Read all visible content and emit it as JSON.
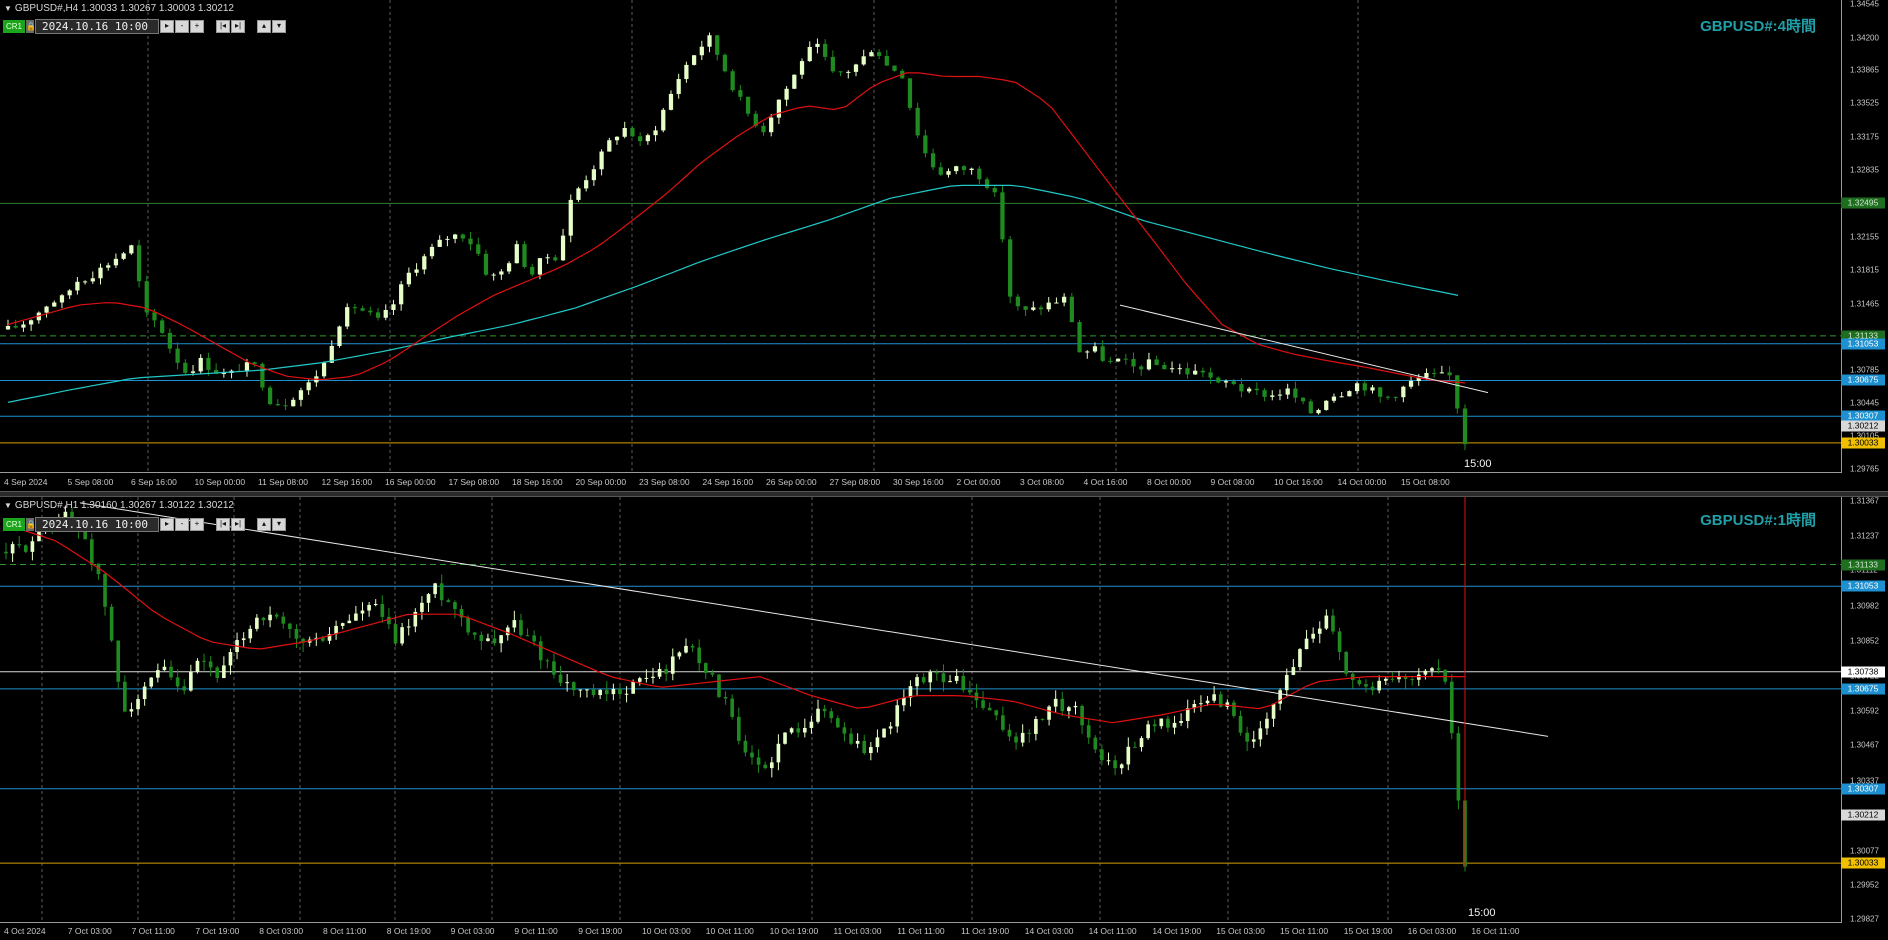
{
  "colors": {
    "background": "#000000",
    "bull": "#e6ffc8",
    "bear": "#1f8a1f",
    "ma_fast": "#e01010",
    "ma_slow": "#20c8c8",
    "grid": "#5a5a5a",
    "level_blue": "#1e90d0",
    "level_gold": "#d4a000",
    "level_green": "#2e7d2e",
    "level_dash": "#2e9a2e",
    "title": "#1f9fa8"
  },
  "panel1": {
    "info": "GBPUSD#,H4  1.30033 1.30267 1.30003 1.30212",
    "cr_label": "CR1",
    "datetime": "2024.10.16 10:00",
    "buttons": [
      "▸",
      "-",
      "+",
      "|◂",
      "▸|",
      "▴",
      "▾"
    ],
    "title": "GBPUSD#:4時間",
    "time_marker": "15:00",
    "y_labels": [
      "1.34545",
      "1.34200",
      "1.33865",
      "1.33525",
      "1.33175",
      "1.32835",
      "1.32495",
      "1.32155",
      "1.31815",
      "1.31465",
      "1.31125",
      "1.30785",
      "1.30445",
      "1.30105",
      "1.29765"
    ],
    "x_labels": [
      "4 Sep 2024",
      "5 Sep 08:00",
      "6 Sep 16:00",
      "10 Sep 00:00",
      "11 Sep 08:00",
      "12 Sep 16:00",
      "16 Sep 00:00",
      "17 Sep 08:00",
      "18 Sep 16:00",
      "20 Sep 00:00",
      "23 Sep 08:00",
      "24 Sep 16:00",
      "26 Sep 00:00",
      "27 Sep 08:00",
      "30 Sep 16:00",
      "2 Oct 00:00",
      "3 Oct 08:00",
      "4 Oct 16:00",
      "8 Oct 00:00",
      "9 Oct 08:00",
      "10 Oct 16:00",
      "14 Oct 00:00",
      "15 Oct 08:00"
    ],
    "price_tags": [
      {
        "value": "1.32495",
        "kind": "green"
      },
      {
        "value": "1.31133",
        "kind": "green"
      },
      {
        "value": "1.31053",
        "kind": "blue"
      },
      {
        "value": "1.30675",
        "kind": "blue"
      },
      {
        "value": "1.30307",
        "kind": "blue"
      },
      {
        "value": "1.30212",
        "kind": "gray"
      },
      {
        "value": "1.30033",
        "kind": "gold"
      }
    ]
  },
  "panel2": {
    "info": "GBPUSD#,H1  1.30160 1.30267 1.30122 1.30212",
    "cr_label": "CR1",
    "datetime": "2024.10.16 10:00",
    "buttons": [
      "▸",
      "-",
      "+",
      "|◂",
      "▸|",
      "▴",
      "▾"
    ],
    "title": "GBPUSD#:1時間",
    "time_marker": "15:00",
    "y_labels": [
      "1.31367",
      "1.31237",
      "1.31112",
      "1.30982",
      "1.30852",
      "1.30722",
      "1.30592",
      "1.30467",
      "1.30337",
      "1.30207",
      "1.30077",
      "1.29952",
      "1.29827"
    ],
    "x_labels": [
      "4 Oct 2024",
      "7 Oct 03:00",
      "7 Oct 11:00",
      "7 Oct 19:00",
      "8 Oct 03:00",
      "8 Oct 11:00",
      "8 Oct 19:00",
      "9 Oct 03:00",
      "9 Oct 11:00",
      "9 Oct 19:00",
      "10 Oct 03:00",
      "10 Oct 11:00",
      "10 Oct 19:00",
      "11 Oct 03:00",
      "11 Oct 11:00",
      "11 Oct 19:00",
      "14 Oct 03:00",
      "14 Oct 11:00",
      "14 Oct 19:00",
      "15 Oct 03:00",
      "15 Oct 11:00",
      "15 Oct 19:00",
      "16 Oct 03:00",
      "16 Oct 11:00"
    ],
    "price_tags": [
      {
        "value": "1.31133",
        "kind": "green"
      },
      {
        "value": "1.31053",
        "kind": "blue"
      },
      {
        "value": "1.30738",
        "kind": "white"
      },
      {
        "value": "1.30675",
        "kind": "blue"
      },
      {
        "value": "1.30307",
        "kind": "blue"
      },
      {
        "value": "1.30212",
        "kind": "gray"
      },
      {
        "value": "1.30033",
        "kind": "gold"
      }
    ]
  },
  "chart_data": [
    {
      "type": "candlestick",
      "title": "GBPUSD#:4時間",
      "timeframe": "H4",
      "ylim": [
        1.29765,
        1.34545
      ],
      "levels": [
        1.32495,
        1.31133,
        1.31053,
        1.30675,
        1.30307,
        1.30033
      ],
      "close_path": [
        1.312,
        1.3125,
        1.3135,
        1.3148,
        1.3152,
        1.317,
        1.3175,
        1.3185,
        1.3195,
        1.3205,
        1.3135,
        1.3125,
        1.3095,
        1.3075,
        1.3088,
        1.3078,
        1.3072,
        1.3082,
        1.3082,
        1.3048,
        1.3042,
        1.3055,
        1.3065,
        1.3085,
        1.3125,
        1.3145,
        1.3138,
        1.3128,
        1.3145,
        1.3175,
        1.319,
        1.3205,
        1.3215,
        1.3218,
        1.3205,
        1.3172,
        1.318,
        1.3205,
        1.3175,
        1.3195,
        1.3195,
        1.3255,
        1.3275,
        1.3295,
        1.3318,
        1.3328,
        1.331,
        1.3325,
        1.3355,
        1.3385,
        1.3405,
        1.342,
        1.3392,
        1.3362,
        1.3338,
        1.3325,
        1.3355,
        1.3375,
        1.3405,
        1.341,
        1.3382,
        1.3385,
        1.3395,
        1.3412,
        1.339,
        1.3385,
        1.3328,
        1.3292,
        1.328,
        1.3285,
        1.3285,
        1.3275,
        1.3252,
        1.3145,
        1.3138,
        1.3142,
        1.3148,
        1.3152,
        1.3095,
        1.31,
        1.3085,
        1.3088,
        1.308,
        1.3085,
        1.3082,
        1.308,
        1.3075,
        1.3078,
        1.3062,
        1.3068,
        1.3055,
        1.3055,
        1.3052,
        1.3058,
        1.3045,
        1.3032,
        1.3052,
        1.3055,
        1.3065,
        1.306,
        1.3048,
        1.3055,
        1.3065,
        1.3072,
        1.3072,
        1.3072,
        1.3002
      ],
      "ma_fast_path": [
        1.3125,
        1.3135,
        1.3145,
        1.3148,
        1.3142,
        1.3125,
        1.3105,
        1.3085,
        1.3072,
        1.3068,
        1.3072,
        1.3088,
        1.3112,
        1.3135,
        1.3155,
        1.317,
        1.3185,
        1.3205,
        1.3232,
        1.326,
        1.3292,
        1.3318,
        1.334,
        1.335,
        1.3345,
        1.3372,
        1.3385,
        1.338,
        1.338,
        1.3375,
        1.3352,
        1.3305,
        1.3258,
        1.3212,
        1.3165,
        1.3125,
        1.3105,
        1.3095,
        1.3088,
        1.3082,
        1.3075,
        1.3068,
        1.3065
      ],
      "ma_slow_path": [
        1.3045,
        1.3058,
        1.307,
        1.3074,
        1.3078,
        1.3086,
        1.3098,
        1.3112,
        1.3125,
        1.3142,
        1.3165,
        1.319,
        1.3212,
        1.3232,
        1.3255,
        1.3268,
        1.3268,
        1.3255,
        1.3232,
        1.3215,
        1.3198,
        1.3182,
        1.3168,
        1.3155
      ],
      "trendline": {
        "from": 1.3145,
        "to": 1.3055
      }
    },
    {
      "type": "candlestick",
      "title": "GBPUSD#:1時間",
      "timeframe": "H1",
      "ylim": [
        1.29827,
        1.31367
      ],
      "levels": [
        1.31133,
        1.31053,
        1.30738,
        1.30675,
        1.30307,
        1.30033
      ],
      "close_path": [
        1.3118,
        1.312,
        1.3128,
        1.3132,
        1.3125,
        1.3102,
        1.306,
        1.3065,
        1.3075,
        1.3065,
        1.3078,
        1.3072,
        1.3085,
        1.3095,
        1.3092,
        1.3085,
        1.3085,
        1.309,
        1.3095,
        1.3098,
        1.3085,
        1.3095,
        1.3105,
        1.3098,
        1.3088,
        1.3085,
        1.3092,
        1.3085,
        1.3075,
        1.3068,
        1.3065,
        1.3065,
        1.3068,
        1.3072,
        1.3075,
        1.3085,
        1.3075,
        1.3062,
        1.3042,
        1.3038,
        1.305,
        1.3055,
        1.306,
        1.3052,
        1.3045,
        1.305,
        1.3062,
        1.3072,
        1.3072,
        1.307,
        1.3062,
        1.3055,
        1.3048,
        1.3055,
        1.3062,
        1.306,
        1.3045,
        1.3038,
        1.3048,
        1.3055,
        1.3055,
        1.306,
        1.3065,
        1.306,
        1.3045,
        1.3058,
        1.3075,
        1.3088,
        1.3095,
        1.3072,
        1.3068,
        1.307,
        1.3072,
        1.3075,
        1.3072,
        1.3002
      ],
      "ma_fast_path": [
        1.3128,
        1.3122,
        1.311,
        1.3095,
        1.3085,
        1.3082,
        1.3085,
        1.309,
        1.3095,
        1.3095,
        1.3088,
        1.308,
        1.3072,
        1.3068,
        1.307,
        1.3072,
        1.3065,
        1.306,
        1.3065,
        1.3065,
        1.3063,
        1.3058,
        1.3055,
        1.3058,
        1.3062,
        1.306,
        1.307,
        1.3072,
        1.3072,
        1.3072
      ],
      "trendline": {
        "from": 1.3136,
        "to": 1.305
      }
    }
  ]
}
